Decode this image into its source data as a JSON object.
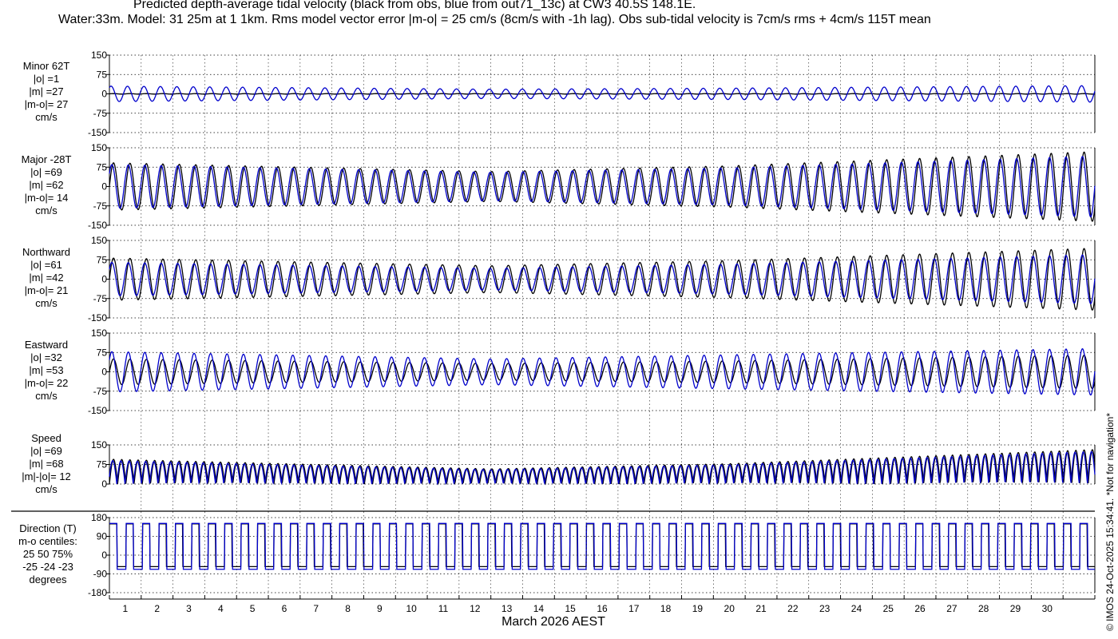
{
  "header": {
    "title_line1": "Predicted depth-average tidal velocity (black from obs, blue from out71_13c) at CW3 40.5S 148.1E.",
    "title_line2": "Water:33m. Model: 31 25m at 1 1km. Rms model vector error |m-o| = 25 cm/s (8cm/s with -1h lag). Obs sub-tidal velocity is 7cm/s rms + 4cm/s 115T mean"
  },
  "footer": {
    "copyright": "© IMOS 24-Oct-2025 15:34:41. *Not for navigation*"
  },
  "colors": {
    "obs": "#000000",
    "model": "#0000cc",
    "grid": "#000000",
    "axis": "#000000"
  },
  "chart_data": {
    "type": "line",
    "xlabel": "March 2026 AEST",
    "xlim": [
      1,
      32
    ],
    "x_ticks": [
      1,
      2,
      3,
      4,
      5,
      6,
      7,
      8,
      9,
      10,
      11,
      12,
      13,
      14,
      15,
      16,
      17,
      18,
      19,
      20,
      21,
      22,
      23,
      24,
      25,
      26,
      27,
      28,
      29,
      30,
      31,
      32
    ],
    "x_tick_labels": [
      "1",
      "2",
      "3",
      "4",
      "5",
      "6",
      "7",
      "8",
      "9",
      "10",
      "11",
      "12",
      "13",
      "14",
      "15",
      "16",
      "17",
      "18",
      "19",
      "20",
      "21",
      "22",
      "23",
      "24",
      "25",
      "26",
      "27",
      "28",
      "29",
      "30"
    ],
    "grid": true,
    "legend": "none",
    "series_styles": [
      {
        "role": "obs",
        "color": "#000000",
        "note": "black from obs"
      },
      {
        "role": "model",
        "color": "#0000cc",
        "note": "blue from out71_13c"
      }
    ],
    "panels": [
      {
        "id": "minor",
        "stats_lines": [
          "Minor 62T",
          "|o| =1",
          "|m| =27",
          "|m-o|= 27",
          "cm/s"
        ],
        "ylim": [
          -150,
          150
        ],
        "yticks": [
          -150,
          -75,
          0,
          75,
          150
        ],
        "ytick_labels": [
          "-150",
          "-75",
          "0",
          "75",
          "150"
        ],
        "obs_amp": [
          1,
          1,
          1,
          1
        ],
        "model_amp": [
          30,
          18,
          22,
          32
        ],
        "phase_shift": [
          0,
          0.15
        ]
      },
      {
        "id": "major",
        "stats_lines": [
          "Major -28T",
          "|o| =69",
          "|m| =62",
          "|m-o|= 14",
          "cm/s"
        ],
        "ylim": [
          -150,
          150
        ],
        "yticks": [
          -150,
          -75,
          0,
          75,
          150
        ],
        "ytick_labels": [
          "-150",
          "-75",
          "0",
          "75",
          "150"
        ],
        "obs_amp": [
          92,
          58,
          80,
          135
        ],
        "model_amp": [
          85,
          55,
          72,
          118
        ],
        "phase_shift": [
          0,
          0.1
        ]
      },
      {
        "id": "northward",
        "stats_lines": [
          "Northward",
          "|o| =61",
          "|m| =42",
          "|m-o|= 21",
          "cm/s"
        ],
        "ylim": [
          -150,
          150
        ],
        "yticks": [
          -150,
          -75,
          0,
          75,
          150
        ],
        "ytick_labels": [
          "-150",
          "-75",
          "0",
          "75",
          "150"
        ],
        "obs_amp": [
          82,
          52,
          72,
          120
        ],
        "model_amp": [
          65,
          42,
          58,
          95
        ],
        "phase_shift": [
          0,
          0.1
        ]
      },
      {
        "id": "eastward",
        "stats_lines": [
          "Eastward",
          "|o| =32",
          "|m| =53",
          "|m-o|= 22",
          "cm/s"
        ],
        "ylim": [
          -150,
          150
        ],
        "yticks": [
          -150,
          -75,
          0,
          75,
          150
        ],
        "ytick_labels": [
          "-150",
          "-75",
          "0",
          "75",
          "150"
        ],
        "obs_amp": [
          50,
          32,
          42,
          65
        ],
        "model_amp": [
          78,
          50,
          66,
          90
        ],
        "phase_shift": [
          0,
          0.1
        ]
      },
      {
        "id": "speed",
        "stats_lines": [
          "Speed",
          "|o| =69",
          "|m| =68",
          "|m|-|o|= 12",
          "cm/s"
        ],
        "ylim": [
          0,
          150
        ],
        "yticks": [
          0,
          75,
          150
        ],
        "ytick_labels": [
          "0",
          "75",
          "150"
        ],
        "obs_amp": [
          95,
          58,
          78,
          132
        ],
        "model_amp": [
          90,
          55,
          74,
          125
        ],
        "phase_shift": [
          0,
          0.05
        ]
      },
      {
        "id": "direction",
        "stats_lines": [
          "Direction (T)",
          "m-o centiles:",
          "25  50  75%",
          "-25 -24 -23",
          "degrees"
        ],
        "ylim": [
          -180,
          180
        ],
        "yticks": [
          -180,
          -90,
          0,
          90,
          180
        ],
        "ytick_labels": [
          "-180",
          "-90",
          "0",
          "90",
          "180"
        ],
        "obs_levels": [
          150,
          -55
        ],
        "model_levels": [
          152,
          -68
        ]
      }
    ],
    "tidal_period_days": 0.5175,
    "amplitude_envelope_days": [
      1,
      13,
      20.5,
      32
    ]
  }
}
